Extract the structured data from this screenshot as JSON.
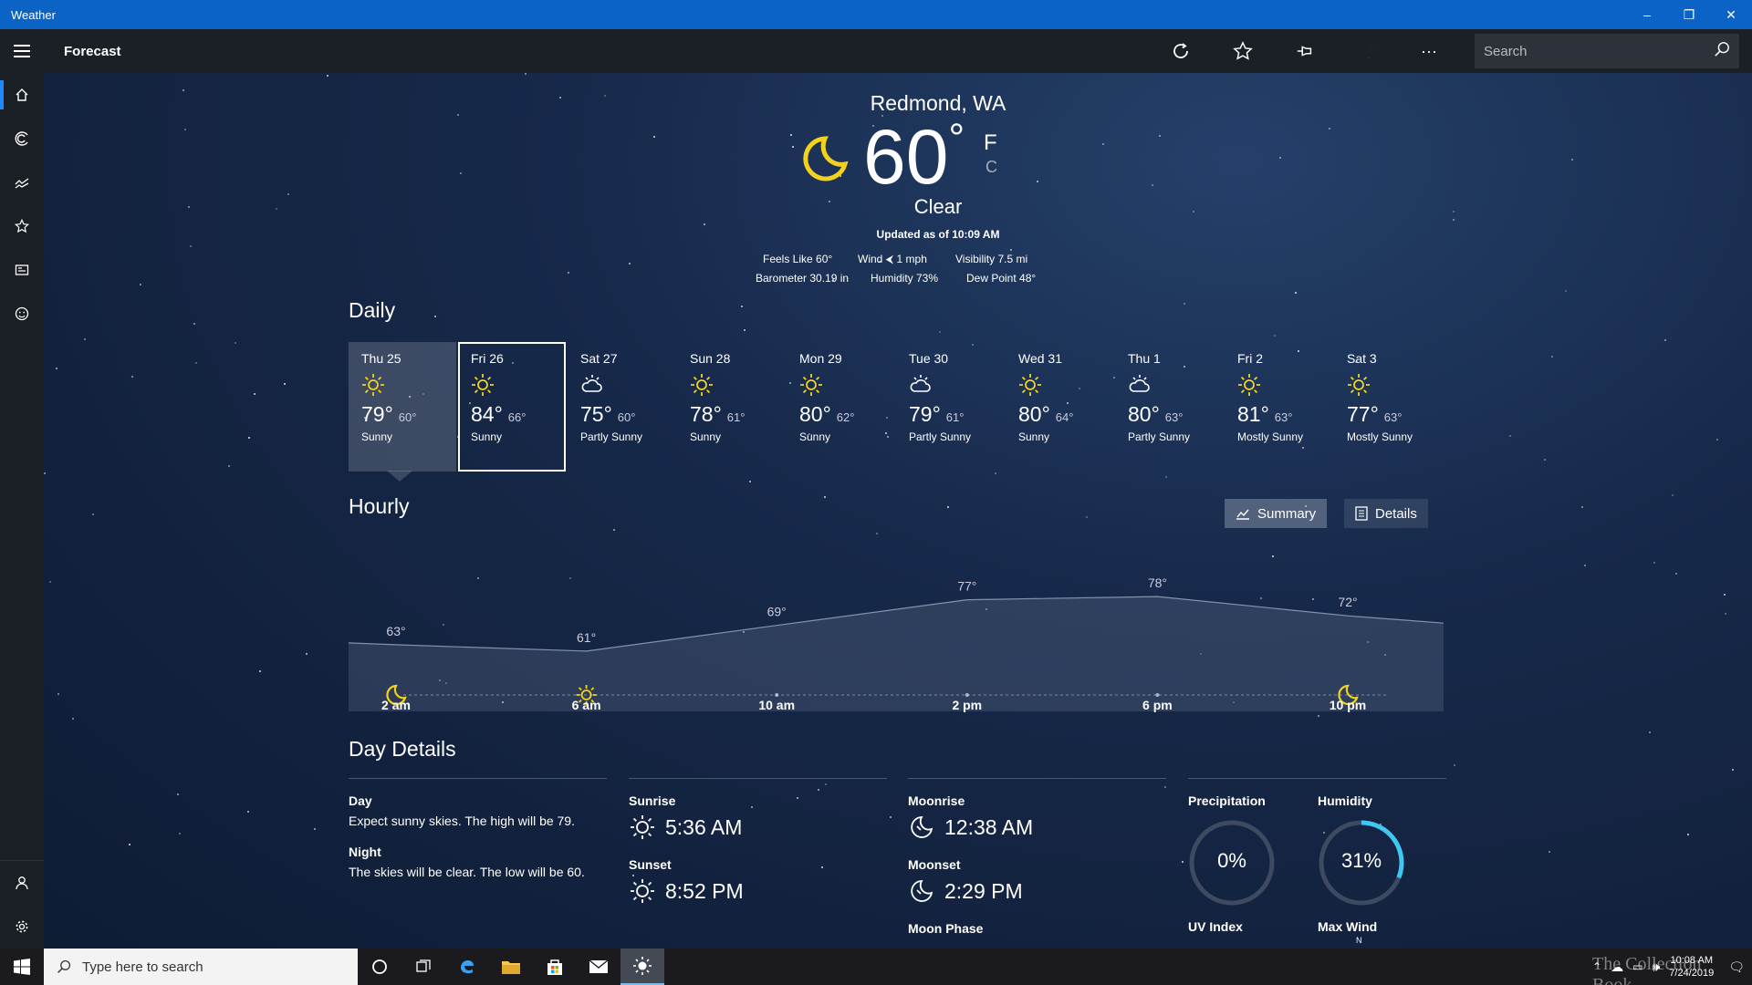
{
  "window": {
    "title": "Weather",
    "minimize": "–",
    "restore": "❐",
    "close": "✕"
  },
  "appbar": {
    "title": "Forecast",
    "search_placeholder": "Search",
    "more": "···"
  },
  "current": {
    "location": "Redmond, WA",
    "temperature": "60",
    "degree": "°",
    "unit_f": "F",
    "unit_c": "C",
    "condition": "Clear",
    "updated": "Updated as of 10:09 AM",
    "stats": {
      "feels_like": "Feels Like  60°",
      "wind": "Wind  ⮜ 1 mph",
      "visibility": "Visibility  7.5 mi",
      "barometer": "Barometer  30.19 in",
      "humidity": "Humidity  73%",
      "dew_point": "Dew Point  48°"
    }
  },
  "daily": {
    "title": "Daily",
    "days": [
      {
        "name": "Thu 25",
        "hi": "79°",
        "lo": "60°",
        "desc": "Sunny",
        "icon": "sun"
      },
      {
        "name": "Fri 26",
        "hi": "84°",
        "lo": "66°",
        "desc": "Sunny",
        "icon": "sun"
      },
      {
        "name": "Sat 27",
        "hi": "75°",
        "lo": "60°",
        "desc": "Partly Sunny",
        "icon": "partly"
      },
      {
        "name": "Sun 28",
        "hi": "78°",
        "lo": "61°",
        "desc": "Sunny",
        "icon": "sun"
      },
      {
        "name": "Mon 29",
        "hi": "80°",
        "lo": "62°",
        "desc": "Sunny",
        "icon": "sun"
      },
      {
        "name": "Tue 30",
        "hi": "79°",
        "lo": "61°",
        "desc": "Partly Sunny",
        "icon": "partly"
      },
      {
        "name": "Wed 31",
        "hi": "80°",
        "lo": "64°",
        "desc": "Sunny",
        "icon": "sun"
      },
      {
        "name": "Thu 1",
        "hi": "80°",
        "lo": "63°",
        "desc": "Partly Sunny",
        "icon": "partly"
      },
      {
        "name": "Fri 2",
        "hi": "81°",
        "lo": "63°",
        "desc": "Mostly Sunny",
        "icon": "sun"
      },
      {
        "name": "Sat 3",
        "hi": "77°",
        "lo": "63°",
        "desc": "Mostly Sunny",
        "icon": "sun"
      }
    ]
  },
  "hourly": {
    "title": "Hourly",
    "summary_label": "Summary",
    "details_label": "Details",
    "labels": [
      "2 am",
      "6 am",
      "10 am",
      "2 pm",
      "6 pm",
      "10 pm"
    ],
    "temps": [
      63,
      61,
      69,
      77,
      78,
      72
    ],
    "temp_labels": [
      "63°",
      "61°",
      "69°",
      "77°",
      "78°",
      "72°"
    ],
    "icons": [
      "moon",
      "sun",
      "",
      "",
      "",
      "moon"
    ]
  },
  "day_details": {
    "title": "Day Details",
    "day_label": "Day",
    "day_text": "Expect sunny skies. The high will be 79.",
    "night_label": "Night",
    "night_text": "The skies will be clear. The low will be 60.",
    "sunrise_label": "Sunrise",
    "sunrise": "5:36 AM",
    "sunset_label": "Sunset",
    "sunset": "8:52 PM",
    "moonrise_label": "Moonrise",
    "moonrise": "12:38 AM",
    "moonset_label": "Moonset",
    "moonset": "2:29 PM",
    "moon_phase_label": "Moon Phase",
    "precip_label": "Precipitation",
    "precip": "0%",
    "precip_fraction": 0,
    "humidity_label": "Humidity",
    "humidity": "31%",
    "humidity_fraction": 0.31,
    "uv_label": "UV Index",
    "wind_label": "Max Wind",
    "wind_dir": "N"
  },
  "taskbar": {
    "search_placeholder": "Type here to search",
    "time": "10:08 AM",
    "date": "7/24/2019",
    "watermark": "The Collection Book"
  },
  "colors": {
    "titlebar": "#0b63c5",
    "accent": "#1e88ff",
    "sun": "#f2d21c",
    "ring": "#3ec7f2"
  }
}
